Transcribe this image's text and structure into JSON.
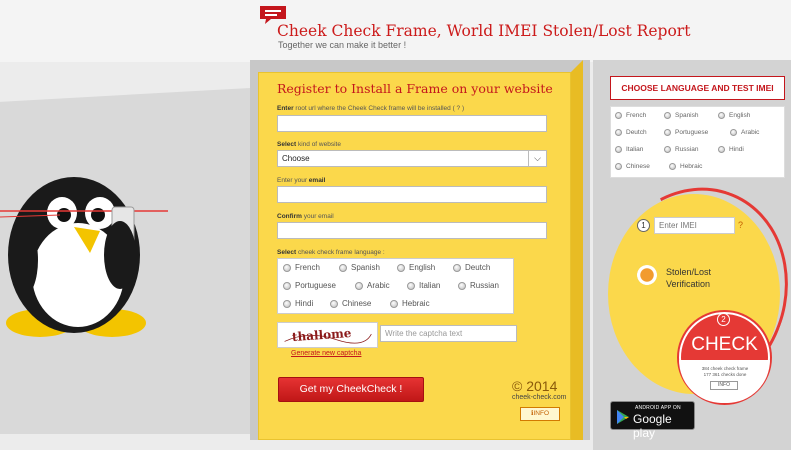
{
  "header": {
    "title": "Cheek Check Frame, World IMEI Stolen/Lost Report",
    "tagline": "Together we can make it better !"
  },
  "form": {
    "title": "Register to Install a Frame on your website",
    "root_url_label_bold": "Enter",
    "root_url_label": " root url where the Cheek Check frame will be installed ( ? )",
    "kind_label_bold": "Select",
    "kind_label": " kind of website",
    "kind_selected": "Choose",
    "email_label": "Enter your ",
    "email_label_bold": "email",
    "confirm_label_bold": "Confirm",
    "confirm_label": " your email",
    "language_label_bold": "Select",
    "language_label": " cheek check frame language :",
    "languages": [
      "French",
      "Spanish",
      "English",
      "Deutch",
      "Portuguese",
      "Arabic",
      "Italian",
      "Russian",
      "Hindi",
      "Chinese",
      "Hebraic"
    ],
    "captcha_text": "thallome",
    "captcha_placeholder": "Write the captcha text",
    "generate_captcha": "Generate new captcha",
    "submit_label": "Get my CheekCheck !",
    "copyright": "© 2014",
    "site_url": "cheek-check.com",
    "info_label": "INFO"
  },
  "test_panel": {
    "choose_language_label": "CHOOSE LANGUAGE AND TEST IMEI",
    "languages": [
      "French",
      "Spanish",
      "English",
      "Deutch",
      "Portuguese",
      "Arabic",
      "Italian",
      "Russian",
      "Hindi",
      "Chinese",
      "Hebraic"
    ],
    "step1": "1",
    "imei_placeholder": "Enter IMEI",
    "help": "?",
    "verification_label_line1": "Stolen/Lost",
    "verification_label_line2": "Verification",
    "step2": "2",
    "check_label": "CHECK",
    "stats_line1": "384 cheek check frame",
    "stats_line2": "177 361 checks done",
    "check_info": "INFO"
  },
  "store_badge": {
    "small": "ANDROID APP ON",
    "big": "Google play"
  },
  "colors": {
    "brand_red": "#c4161c",
    "panel_yellow": "#fbd84b",
    "check_red": "#e53935"
  }
}
